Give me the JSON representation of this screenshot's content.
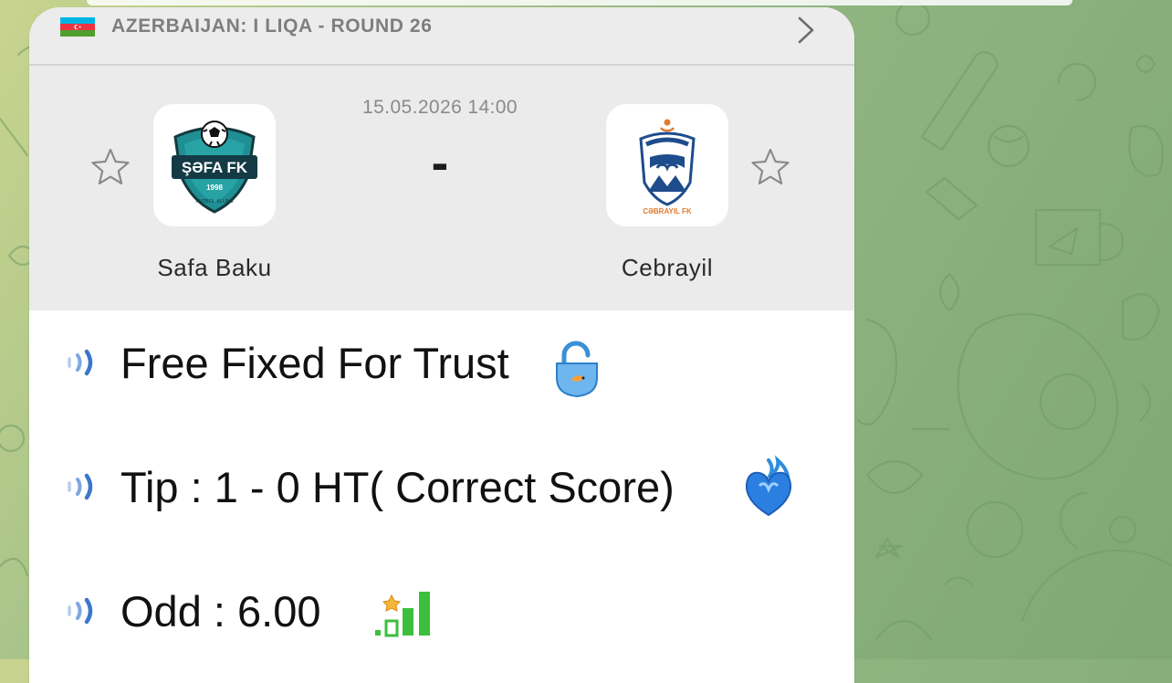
{
  "league": {
    "title": "AZERBAIJAN: I LIQA - ROUND 26",
    "flag_colors": [
      "#00b5e2",
      "#ef3340",
      "#509e2f"
    ]
  },
  "match": {
    "datetime": "15.05.2026 14:00",
    "score_separator": "-",
    "home": {
      "name": "Safa Baku",
      "logo_text": "ŞƏFA FK",
      "logo_year": "1998",
      "logo_subtext": "FUTBOL KLUBU"
    },
    "away": {
      "name": "Cebrayil",
      "logo_text": "CƏBRAYIL FK"
    }
  },
  "messages": [
    {
      "text": "Free Fixed For Trust",
      "emoji": "unlocked-padlock-emoji"
    },
    {
      "text": "Tip : 1 - 0 HT( Correct Score)",
      "emoji": "blue-fire-heart-emoji"
    },
    {
      "text": "Odd : 6.00",
      "emoji": "signal-bars-star-emoji"
    }
  ],
  "colors": {
    "card_bg": "#ebebeb",
    "message_bg": "#ffffff",
    "signal_icon": "#5a8fd6",
    "bars_green": "#3cbf3c"
  }
}
